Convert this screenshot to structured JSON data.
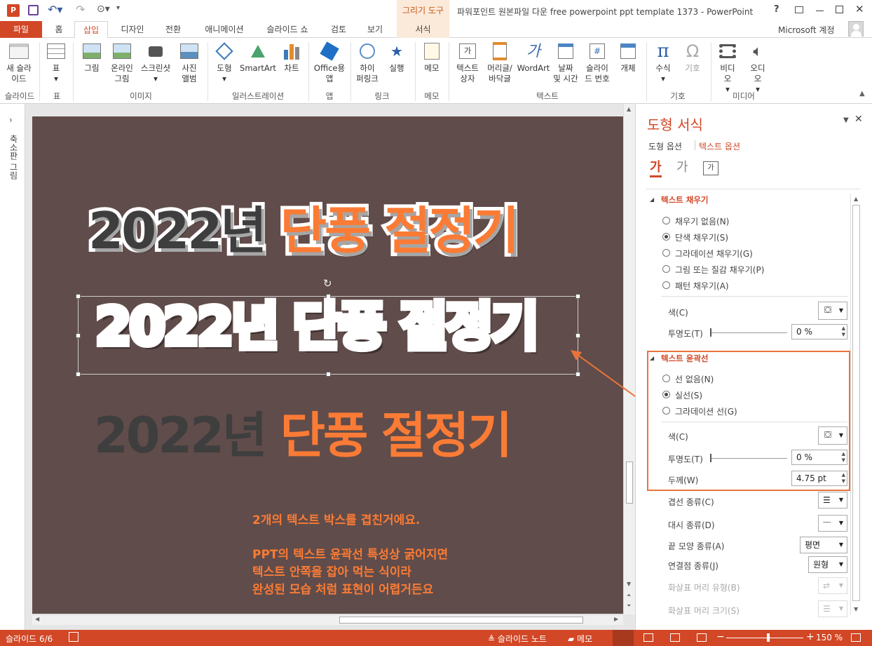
{
  "app": {
    "title": "파워포인트 원본파일 다운 free powerpoint ppt template 1373 - PowerPoint",
    "account": "Microsoft 계정",
    "context_group": "그리기 도구",
    "context_tab": "서식"
  },
  "tabs": [
    "파일",
    "홈",
    "삽입",
    "디자인",
    "전환",
    "애니메이션",
    "슬라이드 쇼",
    "검토",
    "보기"
  ],
  "ribbon": {
    "new_slide": "새 슬라\n이드",
    "table": "표",
    "picture": "그림",
    "online_picture": "온라인\n그림",
    "screenshot": "스크린샷",
    "photo_album": "사진\n앨범",
    "shapes": "도형",
    "smartart": "SmartArt",
    "chart": "차트",
    "office_app": "Office용\n앱",
    "hyperlink": "하이\n퍼링크",
    "action": "실행",
    "comment": "메모",
    "textbox": "텍스트\n상자",
    "header_footer": "머리글/\n바닥글",
    "wordart": "WordArt",
    "datetime": "날짜\n및 시간",
    "slide_number": "슬라이\n드 번호",
    "object": "개체",
    "equation": "수식",
    "symbol": "기호",
    "video": "비디\n오",
    "audio": "오디\n오",
    "groups": {
      "slides": "슬라이드",
      "tables": "표",
      "images": "이미지",
      "illustrations": "일러스트레이션",
      "apps": "앱",
      "links": "링크",
      "comments": "메모",
      "text": "텍스트",
      "symbols": "기호",
      "media": "미디어"
    }
  },
  "left_strip": {
    "label": "축소판 그림"
  },
  "slide": {
    "line1_dark": "2022년",
    "line1_orange": "단풍 절정기",
    "line2": "2022년 단풍 절정기",
    "line3_dark": "2022년",
    "line3_orange": "단풍 절정기",
    "note1": "2개의 텍스트 박스를 겹친거에요.",
    "note2": "PPT의 텍스트 윤곽선 특성상 굵어지면",
    "note3": "텍스트 안쪽을 잡아 먹는 식이라",
    "note4": "완성된 모습 처럼 표현이 어렵거든요"
  },
  "panel": {
    "title": "도형 서식",
    "tab_shape": "도형 옵션",
    "tab_text": "텍스트 옵션",
    "fill_section": "텍스트 채우기",
    "fill_none": "채우기 없음(N)",
    "fill_solid": "단색 채우기(S)",
    "fill_gradient": "그라데이션 채우기(G)",
    "fill_picture": "그림 또는 질감 채우기(P)",
    "fill_pattern": "패턴 채우기(A)",
    "fill_color": "색(C)",
    "fill_transparency": "투명도(T)",
    "fill_transparency_value": "0 %",
    "outline_section": "텍스트 윤곽선",
    "line_none": "선 없음(N)",
    "line_solid": "실선(S)",
    "line_gradient": "그라데이션 선(G)",
    "line_color": "색(C)",
    "line_transparency": "투명도(T)",
    "line_transparency_value": "0 %",
    "line_width": "두께(W)",
    "line_width_value": "4.75 pt",
    "compound_type": "겹선 종류(C)",
    "dash_type": "대시 종류(D)",
    "cap_type": "끝 모양 종류(A)",
    "cap_type_value": "평면",
    "join_type": "연결점 종류(J)",
    "join_type_value": "원형",
    "arrow_begin_type": "화살표 머리 유형(B)",
    "arrow_begin_size": "화살표 머리 크기(S)"
  },
  "status": {
    "slide_counter": "슬라이드 6/6",
    "notes": "슬라이드 노트",
    "comments": "메모",
    "zoom": "150 %"
  },
  "colors": {
    "accent": "#d24726",
    "slide_bg": "#604c4a",
    "orange_text": "#fa7b35",
    "dark_text": "#3e3e3e",
    "highlight_box": "#e8743b"
  }
}
